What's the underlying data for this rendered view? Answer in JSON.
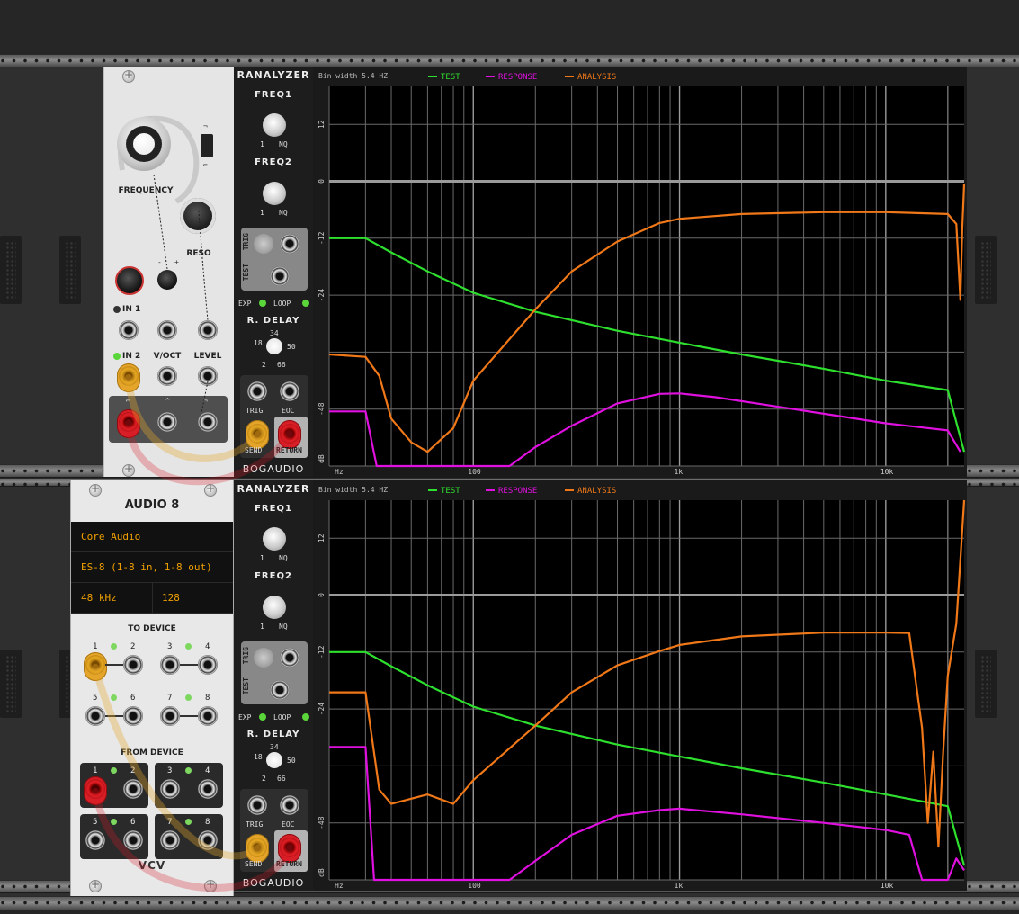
{
  "colors": {
    "test": "#2ee02e",
    "response": "#e010e0",
    "analysis": "#f07818",
    "orange_cable": "#e5a52a",
    "red_cable": "#d81e26",
    "display_text": "#f0a000"
  },
  "vcf": {
    "frequency_label": "FREQUENCY",
    "reso_label": "RESO",
    "in1_label": "IN 1",
    "in2_label": "IN 2",
    "voct_label": "V/OCT",
    "level_label": "LEVEL"
  },
  "audio8": {
    "title": "AUDIO 8",
    "driver": "Core Audio",
    "device": "ES-8 (1-8 in, 1-8 out)",
    "sample_rate": "48 kHz",
    "block_size": "128",
    "to_device_label": "TO DEVICE",
    "from_device_label": "FROM DEVICE",
    "brand": "VCV",
    "port_numbers": [
      "1",
      "2",
      "3",
      "4",
      "5",
      "6",
      "7",
      "8"
    ]
  },
  "ranalyzers": [
    {
      "title": "RANALYZER",
      "freq1_label": "FREQ1",
      "freq2_label": "FREQ2",
      "freq_min": "1",
      "freq_max": "NQ",
      "trig_label": "TRIG",
      "test_label": "TEST",
      "exp_label": "EXP",
      "loop_label": "LOOP",
      "rdelay_label": "R. DELAY",
      "rdelay_marks": [
        "18",
        "34",
        "50",
        "2",
        "66"
      ],
      "eoc_label": "EOC",
      "send_label": "SEND",
      "return_label": "RETURN",
      "brand": "BOGAUDIO",
      "bin_width": "Bin width 5.4 HZ",
      "legend": [
        "TEST",
        "RESPONSE",
        "ANALYSIS"
      ]
    },
    {
      "title": "RANALYZER",
      "freq1_label": "FREQ1",
      "freq2_label": "FREQ2",
      "freq_min": "1",
      "freq_max": "NQ",
      "trig_label": "TRIG",
      "test_label": "TEST",
      "exp_label": "EXP",
      "loop_label": "LOOP",
      "rdelay_label": "R. DELAY",
      "rdelay_marks": [
        "18",
        "34",
        "50",
        "2",
        "66"
      ],
      "eoc_label": "EOC",
      "send_label": "SEND",
      "return_label": "RETURN",
      "brand": "BOGAUDIO",
      "bin_width": "Bin width 5.4 HZ",
      "legend": [
        "TEST",
        "RESPONSE",
        "ANALYSIS"
      ]
    }
  ],
  "chart_data": [
    {
      "type": "line",
      "xscale": "log",
      "xlim": [
        20,
        24000
      ],
      "ylim": [
        -60,
        20
      ],
      "x_ticks": [
        "Hz",
        "100",
        "1k",
        "10k"
      ],
      "y_ticks": [
        "12",
        "0",
        "-12",
        "-24",
        "-48",
        "dB"
      ],
      "series": [
        {
          "name": "TEST",
          "points": [
            [
              20,
              -12
            ],
            [
              30,
              -12
            ],
            [
              40,
              -15
            ],
            [
              60,
              -19
            ],
            [
              100,
              -23.5
            ],
            [
              200,
              -27.5
            ],
            [
              500,
              -31.5
            ],
            [
              1000,
              -34
            ],
            [
              2000,
              -36.5
            ],
            [
              5000,
              -39.5
            ],
            [
              10000,
              -42
            ],
            [
              20000,
              -44
            ],
            [
              24000,
              -57
            ]
          ]
        },
        {
          "name": "RESPONSE",
          "points": [
            [
              20,
              -48.5
            ],
            [
              30,
              -48.5
            ],
            [
              34,
              -60
            ],
            [
              150,
              -60
            ],
            [
              200,
              -56
            ],
            [
              300,
              -51.5
            ],
            [
              500,
              -46.8
            ],
            [
              800,
              -44.8
            ],
            [
              1000,
              -44.7
            ],
            [
              1500,
              -45.5
            ],
            [
              3000,
              -47.5
            ],
            [
              6000,
              -49.5
            ],
            [
              10000,
              -51
            ],
            [
              20000,
              -52.5
            ],
            [
              23000,
              -57
            ]
          ]
        },
        {
          "name": "ANALYSIS",
          "points": [
            [
              20,
              -36.5
            ],
            [
              30,
              -37
            ],
            [
              35,
              -41
            ],
            [
              40,
              -50
            ],
            [
              50,
              -55
            ],
            [
              60,
              -57
            ],
            [
              80,
              -52
            ],
            [
              100,
              -42
            ],
            [
              200,
              -27
            ],
            [
              300,
              -19
            ],
            [
              500,
              -12.7
            ],
            [
              800,
              -8.8
            ],
            [
              1000,
              -7.9
            ],
            [
              2000,
              -6.9
            ],
            [
              5000,
              -6.5
            ],
            [
              10000,
              -6.5
            ],
            [
              20000,
              -6.9
            ],
            [
              22000,
              -9
            ],
            [
              23000,
              -25
            ],
            [
              23500,
              -10
            ],
            [
              24000,
              -0.5
            ]
          ]
        }
      ]
    },
    {
      "type": "line",
      "xscale": "log",
      "xlim": [
        20,
        24000
      ],
      "ylim": [
        -60,
        20
      ],
      "x_ticks": [
        "Hz",
        "100",
        "1k",
        "10k"
      ],
      "y_ticks": [
        "12",
        "0",
        "-12",
        "-24",
        "-48",
        "dB"
      ],
      "series": [
        {
          "name": "TEST",
          "points": [
            [
              20,
              -12
            ],
            [
              30,
              -12
            ],
            [
              40,
              -15
            ],
            [
              60,
              -19
            ],
            [
              100,
              -23.5
            ],
            [
              200,
              -27.5
            ],
            [
              500,
              -31.5
            ],
            [
              1000,
              -34
            ],
            [
              2000,
              -36.5
            ],
            [
              5000,
              -39.5
            ],
            [
              10000,
              -42
            ],
            [
              20000,
              -44.5
            ],
            [
              24000,
              -57
            ]
          ]
        },
        {
          "name": "RESPONSE",
          "points": [
            [
              20,
              -32
            ],
            [
              30,
              -32
            ],
            [
              33,
              -60
            ],
            [
              150,
              -60
            ],
            [
              200,
              -56
            ],
            [
              300,
              -50.5
            ],
            [
              500,
              -46.5
            ],
            [
              800,
              -45.3
            ],
            [
              1000,
              -45
            ],
            [
              2000,
              -46.2
            ],
            [
              5000,
              -48
            ],
            [
              10000,
              -49.5
            ],
            [
              13000,
              -50.5
            ],
            [
              15000,
              -60
            ],
            [
              20000,
              -60
            ],
            [
              22000,
              -55.5
            ],
            [
              24000,
              -58
            ]
          ]
        },
        {
          "name": "ANALYSIS",
          "points": [
            [
              20,
              -20.5
            ],
            [
              30,
              -20.5
            ],
            [
              35,
              -41
            ],
            [
              40,
              -44
            ],
            [
              60,
              -42
            ],
            [
              80,
              -44
            ],
            [
              100,
              -39
            ],
            [
              200,
              -27.5
            ],
            [
              300,
              -20.5
            ],
            [
              500,
              -14.8
            ],
            [
              800,
              -11.8
            ],
            [
              1000,
              -10.5
            ],
            [
              2000,
              -8.7
            ],
            [
              5000,
              -7.9
            ],
            [
              10000,
              -7.9
            ],
            [
              13000,
              -8
            ],
            [
              15000,
              -28
            ],
            [
              16000,
              -48
            ],
            [
              17000,
              -33
            ],
            [
              18000,
              -53
            ],
            [
              19000,
              -33
            ],
            [
              20000,
              -17
            ],
            [
              22000,
              -6
            ],
            [
              24000,
              20
            ]
          ]
        }
      ]
    }
  ]
}
